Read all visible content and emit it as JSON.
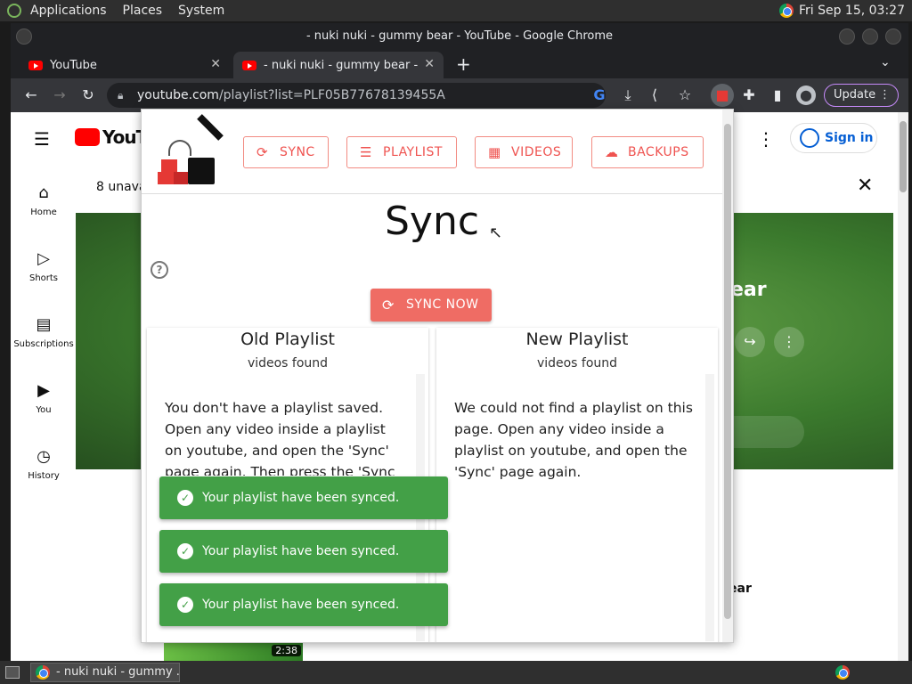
{
  "system_panel": {
    "menus": [
      "Applications",
      "Places",
      "System"
    ],
    "clock": "Fri Sep 15, 03:27"
  },
  "window": {
    "title": "- nuki nuki - gummy bear - YouTube - Google Chrome"
  },
  "tabs": [
    {
      "label": "YouTube",
      "close": "✕"
    },
    {
      "label": "- nuki nuki - gummy bear - Yo",
      "close": "✕"
    }
  ],
  "toolbar": {
    "url_host": "youtube.com",
    "url_path": "/playlist?list=PLF05B77678139455A",
    "update_label": "Update"
  },
  "youtube": {
    "logo": "YouTu",
    "nav": [
      {
        "label": "Home",
        "icon": "home-icon"
      },
      {
        "label": "Shorts",
        "icon": "shorts-icon"
      },
      {
        "label": "Subscriptions",
        "icon": "subscriptions-icon"
      },
      {
        "label": "You",
        "icon": "you-icon"
      },
      {
        "label": "History",
        "icon": "history-icon"
      }
    ],
    "sign_in": "Sign in",
    "notice": "8 unava",
    "hero_title_tail": "ear",
    "below_title_tail": "ear",
    "thumb_duration": "2:38"
  },
  "extension": {
    "nav": {
      "sync": "SYNC",
      "playlist": "PLAYLIST",
      "videos": "VIDEOS",
      "backups": "BACKUPS"
    },
    "page_title": "Sync",
    "help": "?",
    "sync_now": "SYNC NOW",
    "old_playlist": {
      "title": "Old Playlist",
      "subtitle": "videos found",
      "body": "You don't have a playlist saved. Open any video inside a playlist on youtube, and open the 'Sync' page again. Then press the 'Sync now'"
    },
    "new_playlist": {
      "title": "New Playlist",
      "subtitle": "videos found",
      "body": "We could not find a playlist on this page. Open any video inside a playlist on youtube, and open the 'Sync' page again."
    },
    "toasts": [
      "Your playlist have been synced.",
      "Your playlist have been synced.",
      "Your playlist have been synced."
    ]
  },
  "taskbar": {
    "item": "- nuki nuki - gummy ..."
  },
  "colors": {
    "accent": "#ef5350",
    "success": "#43a047",
    "youtube_red": "#ff0000"
  }
}
